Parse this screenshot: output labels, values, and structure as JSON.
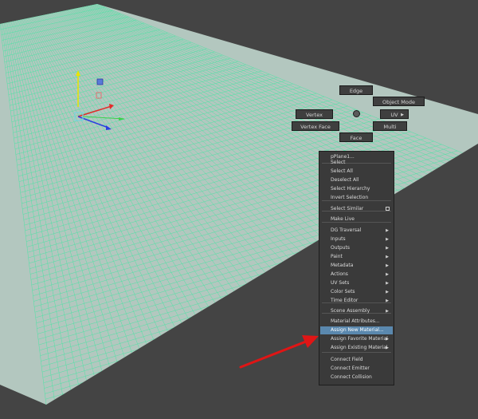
{
  "viewport": {
    "background": "#444444",
    "grid_fill": "#b3c7bf",
    "grid_line": "#4fe3a5",
    "axis_colors": {
      "y": "#e9e300",
      "x": "#e52a2a",
      "z": "#2b3fe0",
      "handle": "#7ad2e0"
    }
  },
  "marking_menu": {
    "edge": "Edge",
    "object_mode": "Object Mode",
    "vertex": "Vertex",
    "uv": "UV",
    "vertex_face": "Vertex Face",
    "multi": "Multi",
    "face": "Face"
  },
  "context_menu": {
    "header": "pPlane1...",
    "items": [
      {
        "label": "Select"
      },
      {
        "label": "Select All"
      },
      {
        "label": "Deselect All"
      },
      {
        "label": "Select Hierarchy"
      },
      {
        "label": "Invert Selection"
      },
      {
        "label": "Select Similar",
        "option_box": true
      },
      {
        "label": "Make Live"
      },
      {
        "label": "DG Traversal",
        "submenu": true
      },
      {
        "label": "Inputs",
        "submenu": true
      },
      {
        "label": "Outputs",
        "submenu": true
      },
      {
        "label": "Paint",
        "submenu": true
      },
      {
        "label": "Metadata",
        "submenu": true
      },
      {
        "label": "Actions",
        "submenu": true
      },
      {
        "label": "UV Sets",
        "submenu": true
      },
      {
        "label": "Color Sets",
        "submenu": true
      },
      {
        "label": "Time Editor",
        "submenu": true
      },
      {
        "label": "Scene Assembly",
        "submenu": true
      },
      {
        "label": "Material Attributes..."
      },
      {
        "label": "Assign New Material...",
        "highlighted": true
      },
      {
        "label": "Assign Favorite Material",
        "submenu": true
      },
      {
        "label": "Assign Existing Material",
        "submenu": true
      },
      {
        "label": "Connect Field"
      },
      {
        "label": "Connect Emitter"
      },
      {
        "label": "Connect Collision"
      }
    ],
    "highlight_color": "#5a88ae"
  },
  "annotation": {
    "arrow_color": "#e01515"
  }
}
